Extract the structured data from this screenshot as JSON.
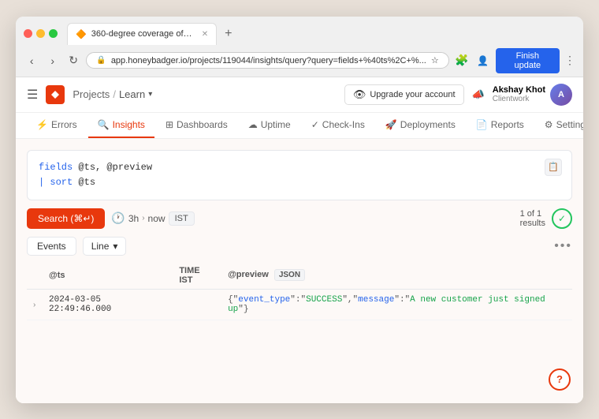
{
  "browser": {
    "tab_title": "360-degree coverage of erro...",
    "tab_favicon": "🔶",
    "url": "app.honeybadger.io/projects/119044/insights/query?query=fields+%40ts%2C+%...",
    "finish_update_label": "Finish update",
    "menu_dots": "⋮"
  },
  "header": {
    "logo_text": "H",
    "breadcrumb_projects": "Projects",
    "breadcrumb_sep": "/",
    "breadcrumb_current": "Learn",
    "breadcrumb_dropdown": "▾",
    "upgrade_label": "Upgrade your account",
    "user_name": "Akshay Khot",
    "user_company": "Clientwork",
    "bell_icon": "📣"
  },
  "nav_tabs": [
    {
      "id": "errors",
      "icon": "⚡",
      "label": "Errors",
      "active": false
    },
    {
      "id": "insights",
      "icon": "🔍",
      "label": "Insights",
      "active": true
    },
    {
      "id": "dashboards",
      "icon": "⊞",
      "label": "Dashboards",
      "active": false
    },
    {
      "id": "uptime",
      "icon": "☁",
      "label": "Uptime",
      "active": false
    },
    {
      "id": "checkins",
      "icon": "✓",
      "label": "Check-Ins",
      "active": false
    },
    {
      "id": "deployments",
      "icon": "🚀",
      "label": "Deployments",
      "active": false
    },
    {
      "id": "reports",
      "icon": "📄",
      "label": "Reports",
      "active": false
    },
    {
      "id": "settings",
      "icon": "⚙",
      "label": "Settings",
      "active": false
    }
  ],
  "query": {
    "line1_kw": "fields",
    "line1_vars": "@ts, @preview",
    "line2_kw": "| sort",
    "line2_vars": "@ts",
    "copy_icon": "📋"
  },
  "search": {
    "button_label": "Search (⌘↵)",
    "time_icon": "🕐",
    "duration": "3h",
    "arrow": "›",
    "time_label": "now",
    "timezone": "IST",
    "result_count": "1 of 1",
    "result_label": "results",
    "check_icon": "✓"
  },
  "table_controls": {
    "events_label": "Events",
    "line_label": "Line",
    "chevron": "▾",
    "more_icon": "•••"
  },
  "table": {
    "columns": [
      "",
      "@ts",
      "TIME IST",
      "@preview",
      "JSON"
    ],
    "rows": [
      {
        "expand": "›",
        "ts": "2024-03-05 22:49:46.000",
        "preview_json": "{\"event_type\":\"SUCCESS\",\"message\":\"A new customer just signed up\"}"
      }
    ]
  },
  "help": {
    "icon": "?"
  }
}
